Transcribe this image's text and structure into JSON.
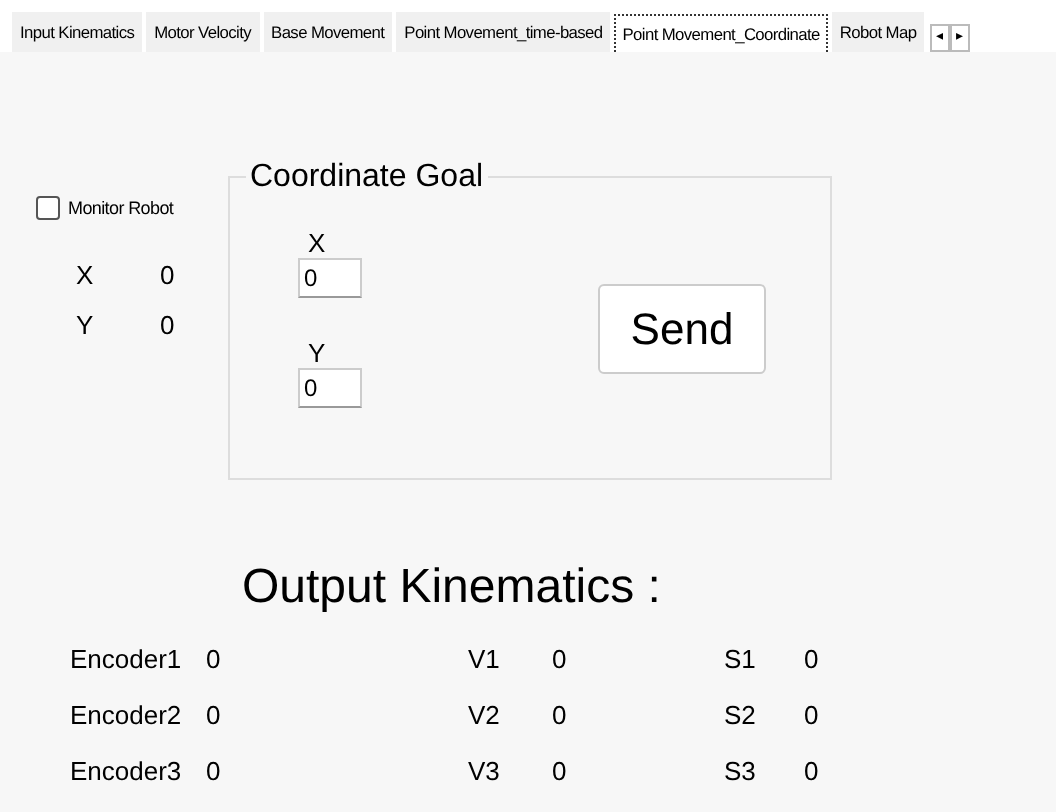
{
  "tabs": [
    {
      "label": "Input Kinematics",
      "selected": false
    },
    {
      "label": "Motor Velocity",
      "selected": false
    },
    {
      "label": "Base Movement",
      "selected": false
    },
    {
      "label": "Point Movement_time-based",
      "selected": false
    },
    {
      "label": "Point Movement_Coordinate",
      "selected": true
    },
    {
      "label": "Robot Map",
      "selected": false
    }
  ],
  "scroll_buttons": [
    "◂",
    "▸"
  ],
  "monitor_robot": {
    "label": "Monitor Robot",
    "checked": false
  },
  "position": [
    {
      "label": "X",
      "value": "0"
    },
    {
      "label": "Y",
      "value": "0"
    }
  ],
  "coordinate_goal": {
    "title": "Coordinate Goal",
    "fields": [
      {
        "label": "X",
        "value": "0"
      },
      {
        "label": "Y",
        "value": "0"
      }
    ],
    "button": "Send"
  },
  "output_title": "Output Kinematics :",
  "outputs": [
    [
      {
        "label": "Encoder1",
        "value": "0"
      },
      {
        "label": "V1",
        "value": "0"
      },
      {
        "label": "S1",
        "value": "0"
      }
    ],
    [
      {
        "label": "Encoder2",
        "value": "0"
      },
      {
        "label": "V2",
        "value": "0"
      },
      {
        "label": "S2",
        "value": "0"
      }
    ],
    [
      {
        "label": "Encoder3",
        "value": "0"
      },
      {
        "label": "V3",
        "value": "0"
      },
      {
        "label": "S3",
        "value": "0"
      }
    ]
  ]
}
